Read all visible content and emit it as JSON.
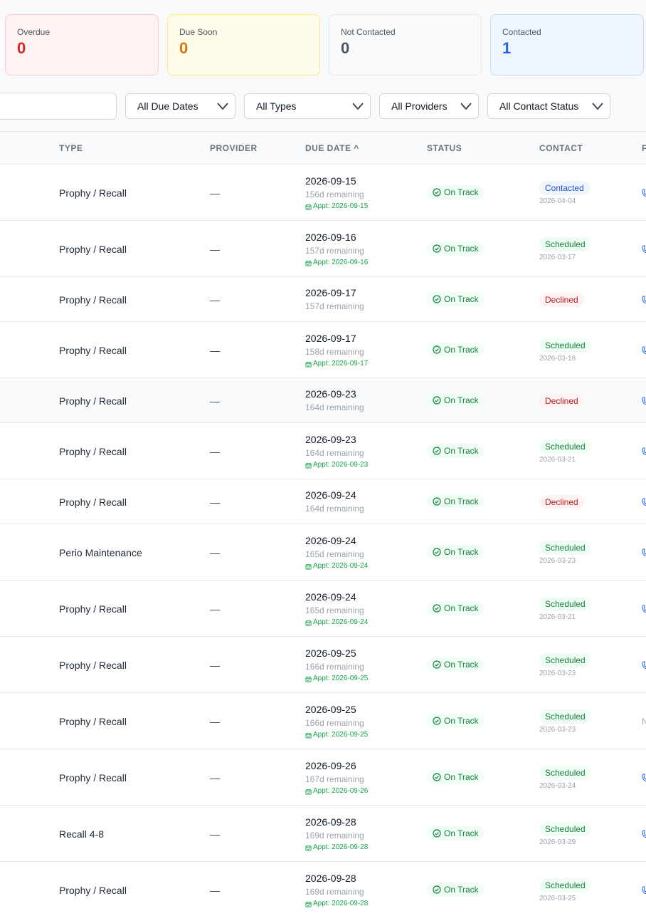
{
  "summary": {
    "overdue": {
      "label": "Overdue",
      "value": "0"
    },
    "due_soon": {
      "label": "Due Soon",
      "value": "0"
    },
    "not_contacted": {
      "label": "Not Contacted",
      "value": "0"
    },
    "contacted": {
      "label": "Contacted",
      "value": "1"
    }
  },
  "filters": {
    "due_dates": "All Due Dates",
    "types": "All Types",
    "providers": "All Providers",
    "contact_status": "All Contact Status"
  },
  "table": {
    "headers": {
      "type": "TYPE",
      "provider": "PROVIDER",
      "due_date": "DUE DATE ^",
      "status": "STATUS",
      "contact": "CONTACT",
      "edge": "F"
    },
    "rows": [
      {
        "type": "Prophy / Recall",
        "provider": "—",
        "due": "2026-09-15",
        "remaining": "156d remaining",
        "appt": "Appt: 2026-09-15",
        "status": "On Track",
        "contact": "Contacted",
        "contact_kind": "contacted",
        "contact_date": "2026-04-04",
        "edge": "icon"
      },
      {
        "type": "Prophy / Recall",
        "provider": "—",
        "due": "2026-09-16",
        "remaining": "157d remaining",
        "appt": "Appt: 2026-09-16",
        "status": "On Track",
        "contact": "Scheduled",
        "contact_kind": "scheduled",
        "contact_date": "2026-03-17",
        "edge": "icon"
      },
      {
        "type": "Prophy / Recall",
        "provider": "—",
        "due": "2026-09-17",
        "remaining": "157d remaining",
        "appt": "",
        "status": "On Track",
        "contact": "Declined",
        "contact_kind": "declined",
        "contact_date": "",
        "edge": "icon"
      },
      {
        "type": "Prophy / Recall",
        "provider": "—",
        "due": "2026-09-17",
        "remaining": "158d remaining",
        "appt": "Appt: 2026-09-17",
        "status": "On Track",
        "contact": "Scheduled",
        "contact_kind": "scheduled",
        "contact_date": "2026-03-18",
        "edge": "icon"
      },
      {
        "type": "Prophy / Recall",
        "provider": "—",
        "due": "2026-09-23",
        "remaining": "164d remaining",
        "appt": "",
        "status": "On Track",
        "contact": "Declined",
        "contact_kind": "declined",
        "contact_date": "",
        "edge": "icon",
        "highlight": true
      },
      {
        "type": "Prophy / Recall",
        "provider": "—",
        "due": "2026-09-23",
        "remaining": "164d remaining",
        "appt": "Appt: 2026-09-23",
        "status": "On Track",
        "contact": "Scheduled",
        "contact_kind": "scheduled",
        "contact_date": "2026-03-21",
        "edge": "icon"
      },
      {
        "type": "Prophy / Recall",
        "provider": "—",
        "due": "2026-09-24",
        "remaining": "164d remaining",
        "appt": "",
        "status": "On Track",
        "contact": "Declined",
        "contact_kind": "declined",
        "contact_date": "",
        "edge": "icon"
      },
      {
        "type": "Perio Maintenance",
        "provider": "—",
        "due": "2026-09-24",
        "remaining": "165d remaining",
        "appt": "Appt: 2026-09-24",
        "status": "On Track",
        "contact": "Scheduled",
        "contact_kind": "scheduled",
        "contact_date": "2026-03-23",
        "edge": "icon"
      },
      {
        "type": "Prophy / Recall",
        "provider": "—",
        "due": "2026-09-24",
        "remaining": "165d remaining",
        "appt": "Appt: 2026-09-24",
        "status": "On Track",
        "contact": "Scheduled",
        "contact_kind": "scheduled",
        "contact_date": "2026-03-21",
        "edge": "icon"
      },
      {
        "type": "Prophy / Recall",
        "provider": "—",
        "due": "2026-09-25",
        "remaining": "166d remaining",
        "appt": "Appt: 2026-09-25",
        "status": "On Track",
        "contact": "Scheduled",
        "contact_kind": "scheduled",
        "contact_date": "2026-03-23",
        "edge": "icon"
      },
      {
        "type": "Prophy / Recall",
        "provider": "—",
        "due": "2026-09-25",
        "remaining": "166d remaining",
        "appt": "Appt: 2026-09-25",
        "status": "On Track",
        "contact": "Scheduled",
        "contact_kind": "scheduled",
        "contact_date": "2026-03-23",
        "edge": "N"
      },
      {
        "type": "Prophy / Recall",
        "provider": "—",
        "due": "2026-09-26",
        "remaining": "167d remaining",
        "appt": "Appt: 2026-09-26",
        "status": "On Track",
        "contact": "Scheduled",
        "contact_kind": "scheduled",
        "contact_date": "2026-03-24",
        "edge": "icon"
      },
      {
        "type": "Recall 4-8",
        "provider": "—",
        "due": "2026-09-28",
        "remaining": "169d remaining",
        "appt": "Appt: 2026-09-28",
        "status": "On Track",
        "contact": "Scheduled",
        "contact_kind": "scheduled",
        "contact_date": "2026-03-29",
        "edge": "icon"
      },
      {
        "type": "Prophy / Recall",
        "provider": "—",
        "due": "2026-09-28",
        "remaining": "169d remaining",
        "appt": "Appt: 2026-09-28",
        "status": "On Track",
        "contact": "Scheduled",
        "contact_kind": "scheduled",
        "contact_date": "2026-03-25",
        "edge": "icon"
      }
    ]
  },
  "colors": {
    "overdue": "#dc2626",
    "due_soon": "#d97706",
    "not_contacted": "#4b5563",
    "contacted": "#2563eb",
    "on_track": "#15803d",
    "declined": "#b91c1c"
  }
}
